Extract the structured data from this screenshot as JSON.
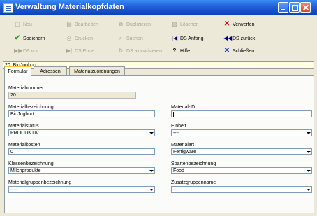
{
  "window": {
    "title": "Verwaltung Materialkopfdaten"
  },
  "toolbar": {
    "neu": "Neu",
    "bearbeiten": "Bearbeiten",
    "duplizieren": "Duplizieren",
    "loeschen": "Löschen",
    "verwerfen": "Verwerfen",
    "speichern": "Speichern",
    "drucken": "Drucken",
    "suchen": "Suchen",
    "ds_anfang": "DS Anfang",
    "ds_zurueck": "DS zurück",
    "ds_vor": "DS vor",
    "ds_ende": "DS Ende",
    "ds_aktualisieren": "DS aktualisieren",
    "hilfe": "Hilfe",
    "schliessen": "Schließen"
  },
  "record_label": "20, BioJoghurt",
  "tabs": [
    "Formular",
    "Adressen",
    "Materialzuordnungen"
  ],
  "form": {
    "materialnummer_label": "Materialnummer",
    "materialnummer_value": "20",
    "materialbezeichnung_label": "Materialbezeichnung",
    "materialbezeichnung_value": "BioJoghurt",
    "material_id_label": "Material-ID",
    "material_id_value": "",
    "materialstatus_label": "Materialstatus",
    "materialstatus_value": "PRODUKTIV",
    "einheit_label": "Einheit",
    "einheit_value": "----",
    "materialkosten_label": "Materialkosten",
    "materialkosten_value": "0",
    "materialart_label": "Materialart",
    "materialart_value": "Fertigware",
    "klassenbezeichnung_label": "Klassenbezeichnung",
    "klassenbezeichnung_value": "Milchprodukte",
    "spartenbezeichnung_label": "Spartenbezeichnung",
    "spartenbezeichnung_value": "Food",
    "materialgruppenbezeichnung_label": "Materialgruppenbezeichnung",
    "materialgruppenbezeichnung_value": "----",
    "zusatzgruppenname_label": "Zusatzgruppenname",
    "zusatzgruppenname_value": "----"
  },
  "colors": {
    "titlebar": "#0A3FB8",
    "window_bg": "#ECE9D8",
    "verwerfen_icon": "#E00000",
    "speichern_icon": "#1E9E1E",
    "nav_icon": "#00008B",
    "record_bg": "#FFFFE1"
  },
  "icons": {
    "neu": "new-document-icon",
    "bearbeiten": "edit-icon",
    "duplizieren": "duplicate-icon",
    "loeschen": "delete-icon",
    "verwerfen": "discard-x-icon",
    "speichern": "save-check-icon",
    "drucken": "print-icon",
    "suchen": "search-icon",
    "ds_anfang": "first-record-icon",
    "ds_zurueck": "previous-record-icon",
    "ds_vor": "next-record-icon",
    "ds_ende": "last-record-icon",
    "ds_aktualisieren": "refresh-icon",
    "hilfe": "help-icon",
    "schliessen": "close-x-icon"
  }
}
